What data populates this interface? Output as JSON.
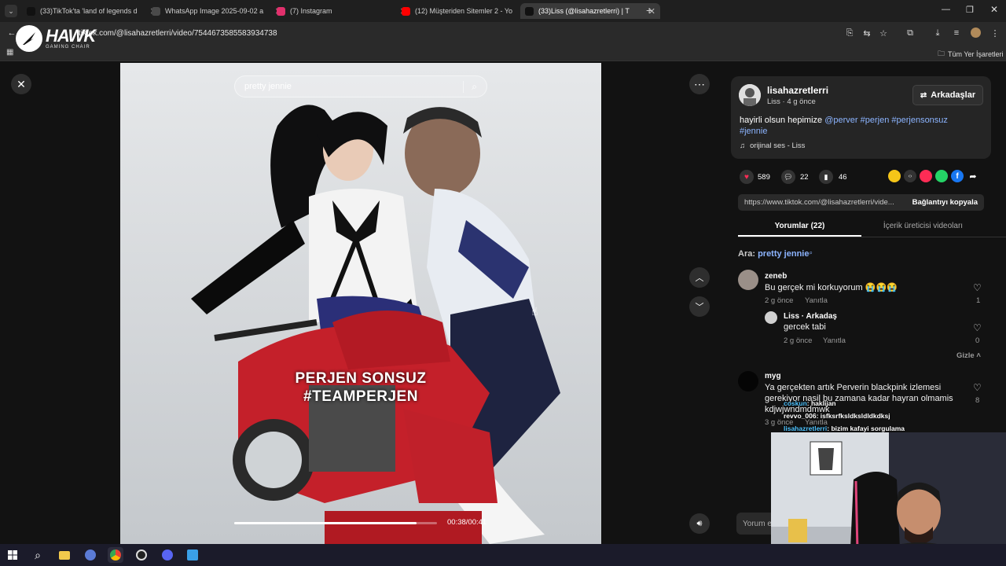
{
  "tabs": [
    {
      "title": "(33)TikTok'ta 'land of legends d",
      "color": "#111"
    },
    {
      "title": "WhatsApp Image 2025-09-02 a",
      "color": "#4a4a4a"
    },
    {
      "title": "(7) Instagram",
      "color": "#e1306c"
    },
    {
      "title": "(12) Müşteriden Sitemler 2 - Yo",
      "color": "#ff0000"
    },
    {
      "title": "(33)Liss (@lisahazretlerri) | T",
      "color": "#111"
    }
  ],
  "address": {
    "url": "tiktok.com/@lisahazretlerri/video/7544673585583934738"
  },
  "bookmarks": {
    "all_label": "Tüm Yer İşaretleri"
  },
  "overlay": {
    "logo_big": "HAWK",
    "logo_small": "GAMING CHAIR"
  },
  "video": {
    "search_text": "pretty jennie",
    "caption_line1": "PERJEN SONSUZ",
    "caption_line2": "#TEAMPERJEN",
    "time": "00:38/00:41",
    "progress": 0.9
  },
  "post": {
    "username": "lisahazretlerri",
    "meta": "Liss · 4 g önce",
    "friends_button": "Arkadaşlar",
    "desc_text": "hayirli olsun hepimize ",
    "desc_tags": "@perver #perjen #perjensonsuz",
    "desc_tag2": "#jennie",
    "sound": "orijinal ses - Liss",
    "likes": "589",
    "comments": "22",
    "saves": "46",
    "link": "https://www.tiktok.com/@lisahazretlerri/vide...",
    "copy_link": "Bağlantıyı kopyala",
    "tab_comments": "Yorumlar (22)",
    "tab_videos": "İçerik üreticisi videoları",
    "search_prefix": "Ara: ",
    "search_term": "pretty jennie"
  },
  "comments": [
    {
      "name": "zeneb",
      "text": "Bu gerçek mi korkuyorum 😭😭😭",
      "meta": "2 g önce",
      "reply": "Yanıtla",
      "likes": "1"
    },
    {
      "name": "Liss · Arkadaş",
      "text": "gercek tabi",
      "meta": "2 g önce",
      "reply": "Yanıtla",
      "likes": "0"
    },
    {
      "name": "myg",
      "text": "Ya gerçekten artık Perverin blackpink izlemesi gerekiyor nasil bu zamana kadar hayran olmamis kdjwjwndmdmwk",
      "meta": "3 g önce",
      "reply": "Yanıtla",
      "likes": "8"
    }
  ],
  "hide_label": "Gizle",
  "input_placeholder": "Yorum ek",
  "live_chat": [
    {
      "user": "coskun",
      "text": ": haklijan",
      "user_color": "#4ec3ff"
    },
    {
      "user": "revvo_006",
      "text": ": isfksrfksldksldldkdksj",
      "user_color": "#e0e0e0"
    },
    {
      "user": "lisahazretlerri",
      "text": ": bizim kafayi sorgulama",
      "user_color": "#4ec3ff"
    }
  ],
  "taskbar_icons": [
    "windows-icon",
    "search-icon",
    "file-explorer-icon",
    "app-icon",
    "chrome-icon",
    "obs-icon",
    "discord-icon",
    "photo-app-icon"
  ]
}
